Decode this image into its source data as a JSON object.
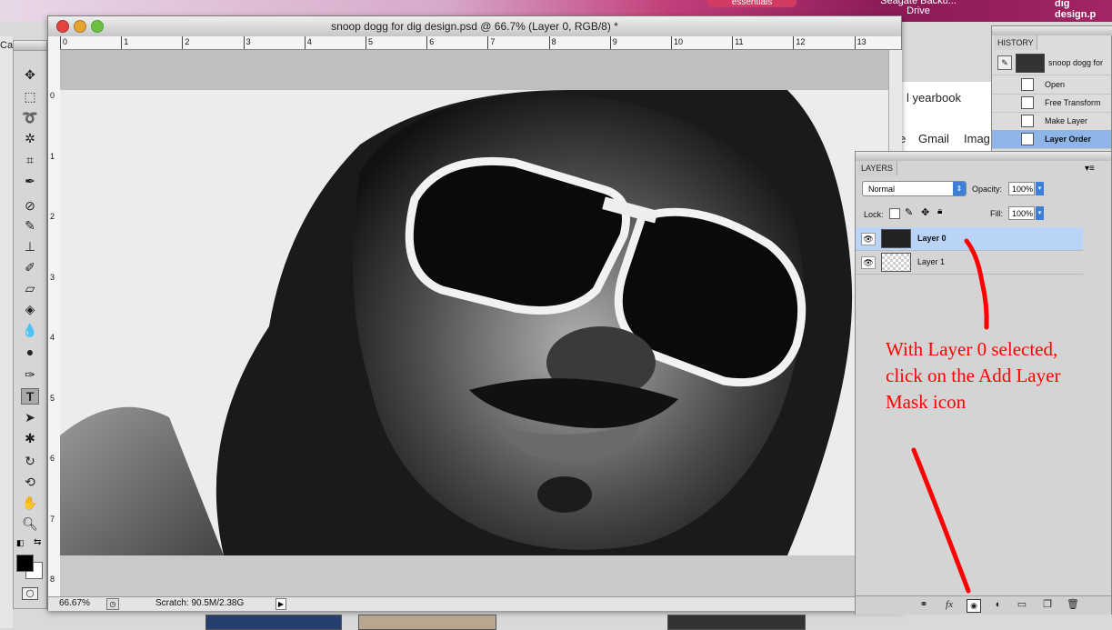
{
  "desktop": {
    "essentials_label": "essentials",
    "drive_label": "Seagate Backu... Drive",
    "file_label": "dig design.p"
  },
  "background_browser": {
    "left_text": "Ca",
    "yearbook": "l yearbook",
    "partial_e": "e",
    "gmail": "Gmail",
    "images": "Imag"
  },
  "document": {
    "title": "snoop dogg for dig design.psd @ 66.7% (Layer 0, RGB/8) *",
    "ruler_top": [
      "0",
      "1",
      "2",
      "3",
      "4",
      "5",
      "6",
      "7",
      "8",
      "9",
      "10",
      "11",
      "12",
      "13"
    ],
    "ruler_left": [
      "0",
      "1",
      "2",
      "3",
      "4",
      "5",
      "6",
      "7",
      "8"
    ],
    "zoom": "66.67%",
    "scratch": "Scratch: 90.5M/2.38G"
  },
  "history": {
    "tab": "HISTORY",
    "snapshot": "snoop dogg for",
    "items": [
      "Open",
      "Free Transform",
      "Make Layer",
      "Layer Order"
    ],
    "selected_index": 3
  },
  "layers": {
    "tab": "LAYERS",
    "blend_mode": "Normal",
    "opacity_label": "Opacity:",
    "opacity_value": "100%",
    "lock_label": "Lock:",
    "fill_label": "Fill:",
    "fill_value": "100%",
    "items": [
      {
        "name": "Layer 0",
        "selected": true
      },
      {
        "name": "Layer 1",
        "selected": false
      }
    ],
    "footer_icons": [
      "link-icon",
      "fx-icon",
      "add-layer-mask-icon",
      "adjustment-layer-icon",
      "folder-icon",
      "new-layer-icon",
      "trash-icon"
    ]
  },
  "annotation": "With Layer 0 selected, click on the Add Layer Mask icon",
  "colors": {
    "annotation": "#ff0000",
    "selection": "#b9d4f6",
    "history_selection": "#8eb5e8"
  }
}
